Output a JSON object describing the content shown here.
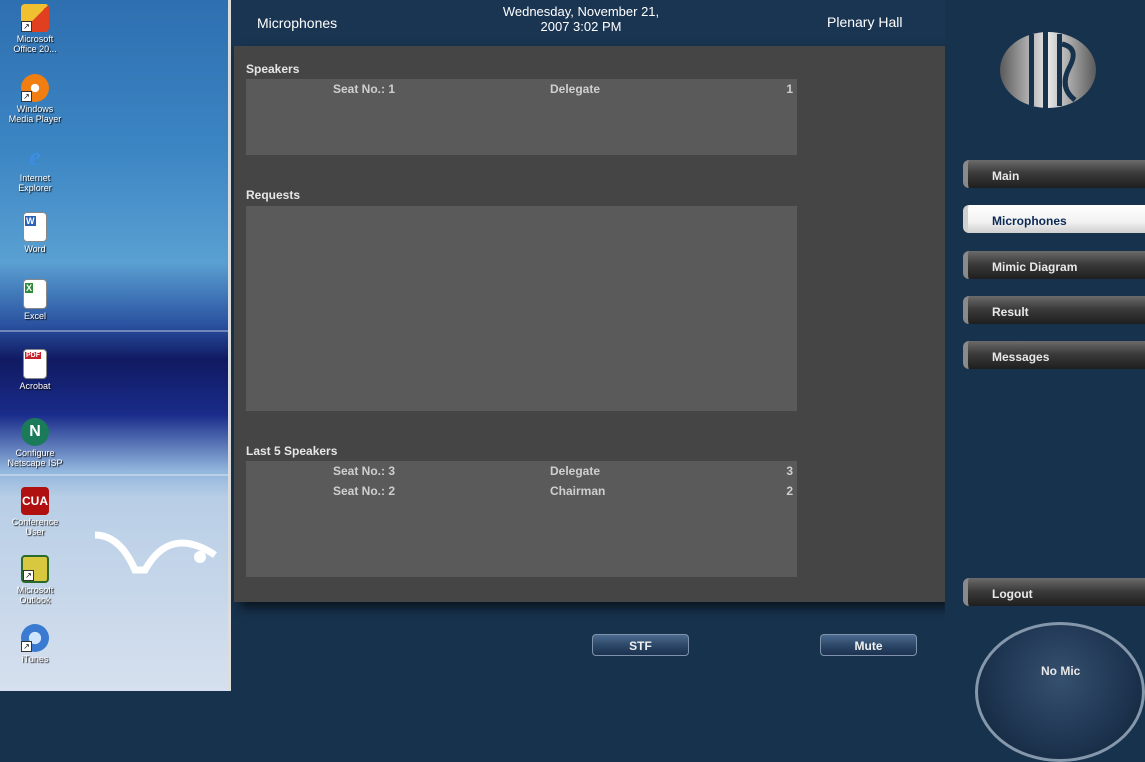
{
  "desktop": {
    "icons": [
      {
        "label": "Microsoft\nOffice 20...",
        "icon": "office-icon",
        "color": "#e8a23a"
      },
      {
        "label": "Windows\nMedia Player",
        "icon": "media-player-icon",
        "color": "#f07e10"
      },
      {
        "label": "Internet\nExplorer",
        "icon": "ie-icon",
        "color": "#3b8ee0"
      },
      {
        "label": "Word",
        "icon": "word-icon",
        "color": "#2b5fb8"
      },
      {
        "label": "Excel",
        "icon": "excel-icon",
        "color": "#2e8b3a"
      },
      {
        "label": "Acrobat",
        "icon": "acrobat-icon",
        "color": "#c8202a"
      },
      {
        "label": "Configure\nNetscape ISP",
        "icon": "netscape-icon",
        "color": "#1a7a5a"
      },
      {
        "label": "Conference\nUser",
        "icon": "cua-icon",
        "color": "#b01010"
      },
      {
        "label": "Microsoft\nOutlook",
        "icon": "outlook-icon",
        "color": "#d8c840"
      },
      {
        "label": "iTunes",
        "icon": "itunes-icon",
        "color": "#3a7ad0"
      }
    ],
    "acrobat_badge": "PDF",
    "netscape_letter": "N",
    "cua_text": "CUA"
  },
  "header": {
    "title": "Microphones",
    "datetime": "Wednesday, November 21,\n2007 3:02 PM",
    "hall": "Plenary Hall"
  },
  "speakers": {
    "label": "Speakers",
    "rows": [
      {
        "seat": "Seat No.: 1",
        "role": "Delegate",
        "num": "1"
      }
    ]
  },
  "requests": {
    "label": "Requests",
    "rows": []
  },
  "last_speakers": {
    "label": "Last 5 Speakers",
    "rows": [
      {
        "seat": "Seat No.: 3",
        "role": "Delegate",
        "num": "3"
      },
      {
        "seat": "Seat No.: 2",
        "role": "Chairman",
        "num": "2"
      }
    ]
  },
  "nav": [
    {
      "label": "Main",
      "active": false
    },
    {
      "label": "Microphones",
      "active": true
    },
    {
      "label": "Mimic Diagram",
      "active": false
    },
    {
      "label": "Result",
      "active": false
    },
    {
      "label": "Messages",
      "active": false
    }
  ],
  "logout_label": "Logout",
  "stf_label": "STF",
  "mute_label": "Mute",
  "nomic_label": "No Mic"
}
